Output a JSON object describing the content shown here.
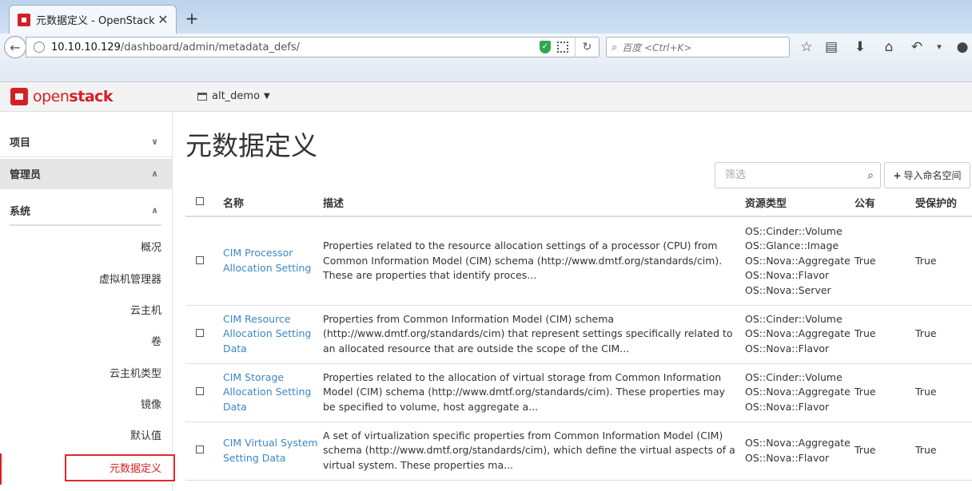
{
  "browser": {
    "tab_title": "元数据定义 - OpenStack ...",
    "tab_close": "✕",
    "new_tab": "+",
    "url_host": "10.10.10.129",
    "url_path": "/dashboard/admin/metadata_defs/",
    "search_placeholder": "百度 <Ctrl+K>"
  },
  "header": {
    "logo_text_light": "open",
    "logo_text_bold": "stack",
    "project": "alt_demo"
  },
  "sidebar": {
    "sections": [
      {
        "label": "项目"
      },
      {
        "label": "管理员"
      }
    ],
    "subsection": {
      "label": "系统"
    },
    "items": [
      {
        "label": "概况"
      },
      {
        "label": "虚拟机管理器"
      },
      {
        "label": "云主机"
      },
      {
        "label": "卷"
      },
      {
        "label": "云主机类型"
      },
      {
        "label": "镜像"
      },
      {
        "label": "默认值"
      },
      {
        "label": "元数据定义"
      }
    ]
  },
  "main": {
    "title": "元数据定义",
    "filter_placeholder": "筛选",
    "import_label": "导入命名空间",
    "columns": {
      "name": "名称",
      "desc": "描述",
      "res": "资源类型",
      "pub": "公有",
      "prot": "受保护的"
    },
    "rows": [
      {
        "name": "CIM Processor Allocation Setting",
        "desc": "Properties related to the resource allocation settings of a processor (CPU) from Common Information Model (CIM) schema (http://www.dmtf.org/standards/cim). These are properties that identify proces...",
        "res": [
          "OS::Cinder::Volume",
          "OS::Glance::Image",
          "OS::Nova::Aggregate",
          "OS::Nova::Flavor",
          "OS::Nova::Server"
        ],
        "pub": "True",
        "prot": "True"
      },
      {
        "name": "CIM Resource Allocation Setting Data",
        "desc": "Properties from Common Information Model (CIM) schema (http://www.dmtf.org/standards/cim) that represent settings specifically related to an allocated resource that are outside the scope of the CIM...",
        "res": [
          "OS::Cinder::Volume",
          "OS::Nova::Aggregate",
          "OS::Nova::Flavor"
        ],
        "pub": "True",
        "prot": "True"
      },
      {
        "name": "CIM Storage Allocation Setting Data",
        "desc": "Properties related to the allocation of virtual storage from Common Information Model (CIM) schema (http://www.dmtf.org/standards/cim). These properties may be specified to volume, host aggregate a...",
        "res": [
          "OS::Cinder::Volume",
          "OS::Nova::Aggregate",
          "OS::Nova::Flavor"
        ],
        "pub": "True",
        "prot": "True"
      },
      {
        "name": "CIM Virtual System Setting Data",
        "desc": "A set of virtualization specific properties from Common Information Model (CIM) schema (http://www.dmtf.org/standards/cim), which define the virtual aspects of a virtual system. These properties ma...",
        "res": [
          "OS::Nova::Aggregate",
          "OS::Nova::Flavor"
        ],
        "pub": "True",
        "prot": "True"
      }
    ]
  },
  "colors": {
    "brand": "#d32027",
    "link": "#3e86c5",
    "highlight": "#e0282e"
  }
}
